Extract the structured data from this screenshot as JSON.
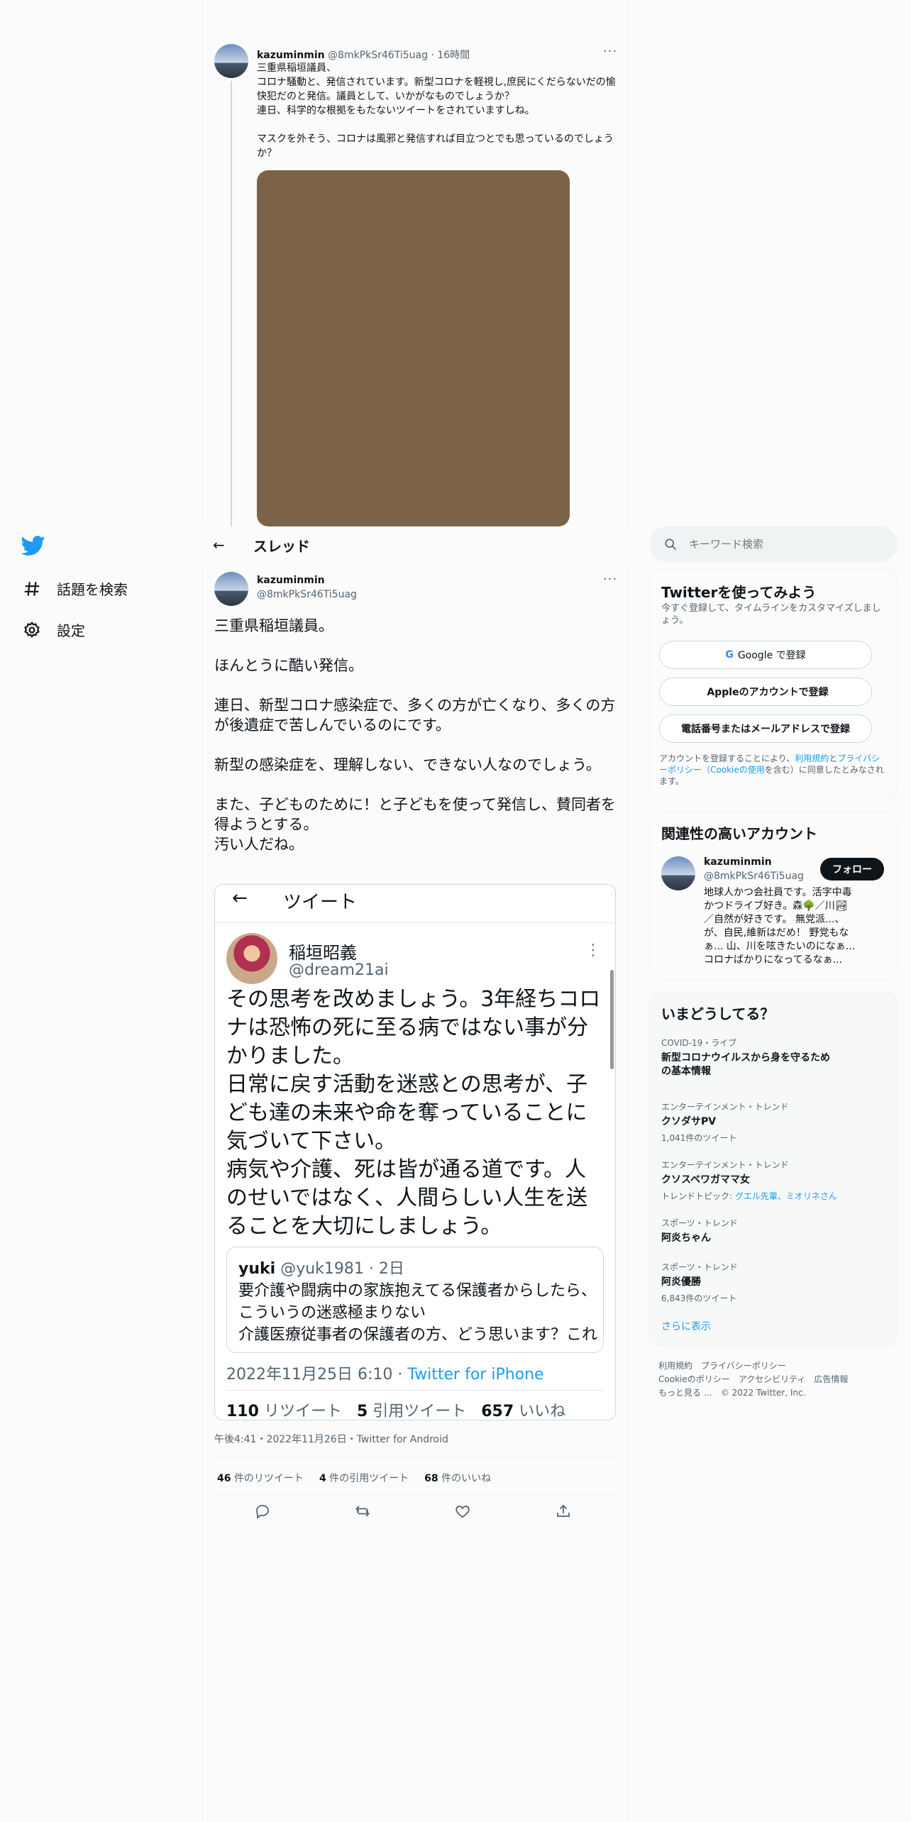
{
  "nav": {
    "explore": "話題を検索",
    "settings": "設定"
  },
  "parent_tweet": {
    "name": "kazuminmin",
    "handle": "@8mkPkSr46Ti5uag",
    "time": "16時間",
    "body": "三重県稲垣議員、\nコロナ騒動と、発信されています。新型コロナを軽視し,庶民にくだらないだの愉快犯だのと発信。議員として、いかがなものでしょうか？\n連日、科学的な根拠をもたないツイートをされていますしね。\n\nマスクを外そう、コロナは風邪と発信すれば目立つとでも思っているのでしょうか？"
  },
  "header": {
    "title": "スレッド"
  },
  "main_tweet": {
    "name": "kazuminmin",
    "handle": "@8mkPkSr46Ti5uag",
    "body": "三重県稲垣議員。\n\nほんとうに酷い発信。\n\n連日、新型コロナ感染症で、多くの方が亡くなり、多くの方が後遺症で苦しんでいるのにです。\n\n新型の感染症を、理解しない、できない人なのでしょう。\n\nまた、子どものために！と子どもを使って発信し、賛同者を得ようとする。\n汚い人だね。",
    "date": "午後4:41・2022年11月26日・Twitter for Android",
    "retweets_count": "46",
    "retweets_label": "件のリツイート",
    "quotes_count": "4",
    "quotes_label": "件の引用ツイート",
    "likes_count": "68",
    "likes_label": "件のいいね"
  },
  "embedded": {
    "title": "ツイート",
    "name": "稲垣昭義",
    "handle": "@dream21ai",
    "body": "その思考を改めましょう。3年経ちコロナは恐怖の死に至る病ではない事が分かりました。\n日常に戻す活動を迷惑との思考が、子ども達の未来や命を奪っていることに気づいて下さい。\n病気や介護、死は皆が通る道です。人のせいではなく、人間らしい人生を送ることを大切にしましょう。",
    "quote_name": "yuki",
    "quote_handle_time": "@yuk1981 · 2日",
    "quote_body": "要介護や闘病中の家族抱えてる保護者からしたら、こういうの迷惑極まりない\n介護医療従事者の保護者の方、どう思います？これ",
    "date": "2022年11月25日 6:10 · ",
    "source": "Twitter for iPhone",
    "rt_count": "110",
    "rt_label": "リツイート",
    "quote_count": "5",
    "quote_label": "引用ツイート",
    "like_count": "657",
    "like_label": "いいね"
  },
  "search": {
    "placeholder": "キーワード検索"
  },
  "signup": {
    "title": "Twitterを使ってみよう",
    "subtitle": "今すぐ登録して、タイムラインをカスタマイズしましょう。",
    "google": "Google で登録",
    "apple": "Appleのアカウントで登録",
    "phone": "電話番号またはメールアドレスで登録",
    "legal_pre": "アカウントを登録することにより、",
    "legal_terms": "利用規約",
    "legal_and": "と",
    "legal_privacy": "プライバシーポリシー（Cookieの使用",
    "legal_post": "を含む）に同意したとみなされます。"
  },
  "related": {
    "title": "関連性の高いアカウント",
    "name": "kazuminmin",
    "handle": "@8mkPkSr46Ti5uag",
    "follow": "フォロー",
    "bio": "地球人かつ会社員です。活字中毒かつドライブ好き。森🌳／川🏞／自然が好きです。 無党派...、が、自民,維新はだめ！ 野党もなぁ... 山、川を呟きたいのになぁ... コロナばかりになってるなぁ..."
  },
  "trends": {
    "title": "いまどうしてる？",
    "items": [
      {
        "meta": "COVID-19・ライブ",
        "name": "新型コロナウイルスから身を守るための基本情報",
        "sub": ""
      },
      {
        "meta": "エンターテインメント・トレンド",
        "name": "クソダサPV",
        "sub": "1,041件のツイート"
      },
      {
        "meta": "エンターテインメント・トレンド",
        "name": "クソスベワガママ女",
        "sub_pre": "トレンドトピック: ",
        "sub_link": "グエル先輩、ミオリネさん"
      },
      {
        "meta": "スポーツ・トレンド",
        "name": "阿炎ちゃん",
        "sub": ""
      },
      {
        "meta": "スポーツ・トレンド",
        "name": "阿炎優勝",
        "sub": "6,843件のツイート"
      }
    ],
    "more": "さらに表示"
  },
  "footer": {
    "terms": "利用規約",
    "privacy": "プライバシーポリシー",
    "cookie": "Cookieのポリシー",
    "accessibility": "アクセシビリティ",
    "ads": "広告情報",
    "more": "もっと見る …",
    "copyright": "© 2022 Twitter, Inc."
  }
}
